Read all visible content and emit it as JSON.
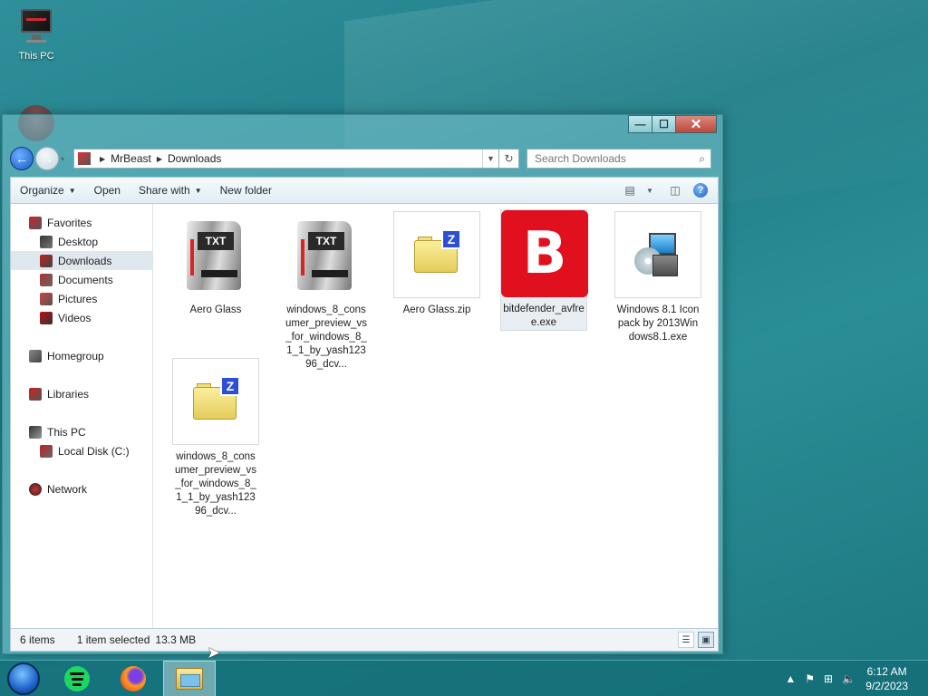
{
  "desktop": {
    "this_pc_label": "This PC"
  },
  "window": {
    "controls": {
      "minimize": "—",
      "maximize": "☐",
      "close": "✕"
    },
    "address": {
      "crumbs": [
        "MrBeast",
        "Downloads"
      ]
    },
    "search": {
      "placeholder": "Search Downloads"
    },
    "toolbar": {
      "organize": "Organize",
      "open": "Open",
      "share_with": "Share with",
      "new_folder": "New folder"
    },
    "nav_pane": {
      "favorites": "Favorites",
      "desktop": "Desktop",
      "downloads": "Downloads",
      "documents": "Documents",
      "pictures": "Pictures",
      "videos": "Videos",
      "homegroup": "Homegroup",
      "libraries": "Libraries",
      "this_pc": "This PC",
      "local_disk": "Local Disk (C:)",
      "network": "Network"
    },
    "files": [
      {
        "name": "Aero Glass",
        "icon": "txt-document-icon"
      },
      {
        "name": "windows_8_consumer_preview_vs_for_windows_8_1_1_by_yash12396_dcv...",
        "icon": "txt-document-icon"
      },
      {
        "name": "Aero Glass.zip",
        "icon": "zip-folder-icon"
      },
      {
        "name": "bitdefender_avfree.exe",
        "icon": "bitdefender-icon",
        "selected": true
      },
      {
        "name": "Windows 8.1 Iconpack by 2013Windows8.1.exe",
        "icon": "setup-installer-icon"
      },
      {
        "name": "windows_8_consumer_preview_vs_for_windows_8_1_1_by_yash12396_dcv...",
        "icon": "zip-folder-icon"
      }
    ],
    "status": {
      "count": "6 items",
      "selected": "1 item selected",
      "size": "13.3 MB"
    }
  },
  "taskbar": {
    "time": "6:12 AM",
    "date": "9/2/2023"
  },
  "colors": {
    "accent": "#1f62c8",
    "bitdefender": "#e0101e",
    "desktop": "#1f7e88"
  }
}
